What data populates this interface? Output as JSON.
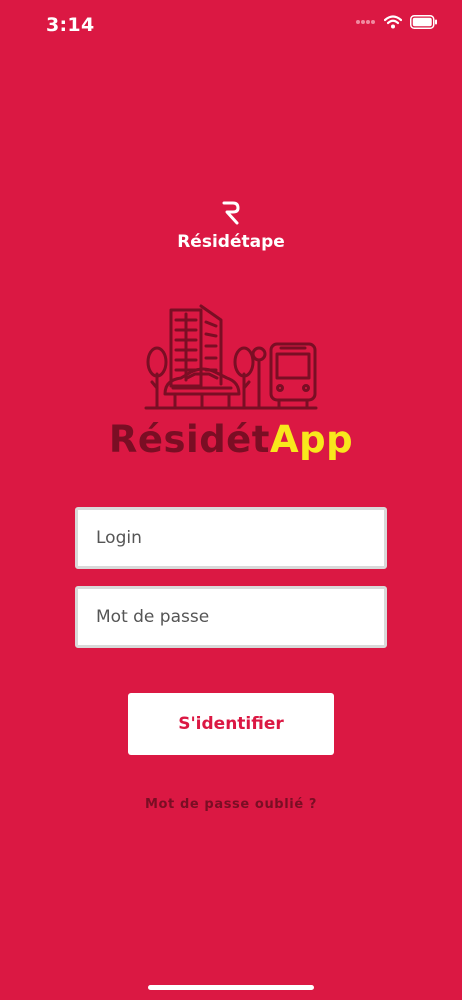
{
  "status_bar": {
    "time": "3:14"
  },
  "brand": {
    "name": "Résidétape"
  },
  "app_title": {
    "part1": "Résidét",
    "part2": "App"
  },
  "form": {
    "login_placeholder": "Login",
    "password_placeholder": "Mot de passe",
    "submit_label": "S'identifier",
    "forgot_label": "Mot de passe oublié ?"
  },
  "colors": {
    "background": "#DB1843",
    "accent_dark": "#7A0E24",
    "accent_yellow": "#F8E81C",
    "field_background": "#FFFFFF"
  },
  "icons": [
    "signal-icon",
    "wifi-icon",
    "battery-icon",
    "residetape-logo-icon",
    "city-illustration"
  ]
}
